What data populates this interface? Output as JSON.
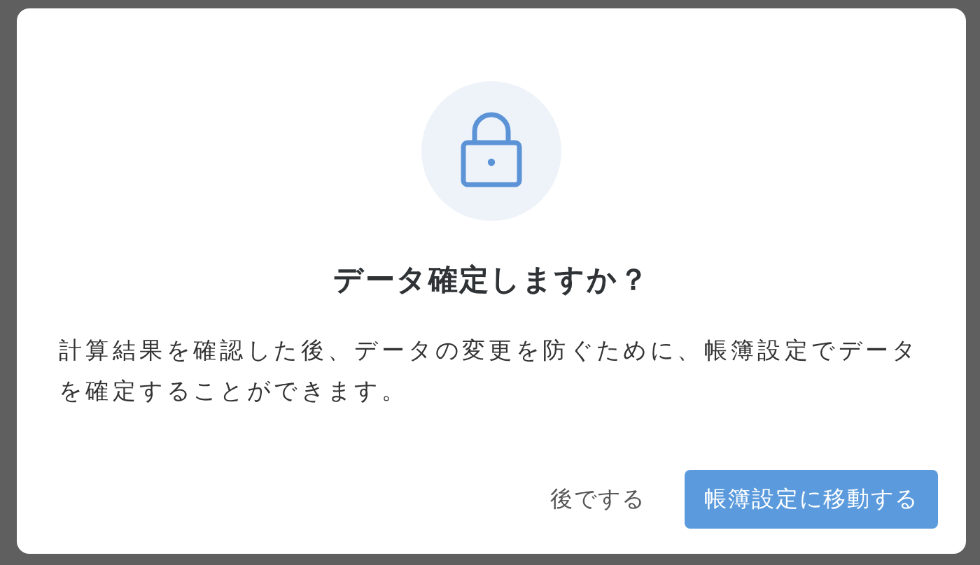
{
  "dialog": {
    "title": "データ確定しますか？",
    "message": "計算結果を確認した後、データの変更を防ぐために、帳簿設定でデータを確定することができます。",
    "buttons": [
      {
        "label": "後でする",
        "kind": "text"
      },
      {
        "label": "帳簿設定に移動する",
        "kind": "primary"
      }
    ]
  }
}
